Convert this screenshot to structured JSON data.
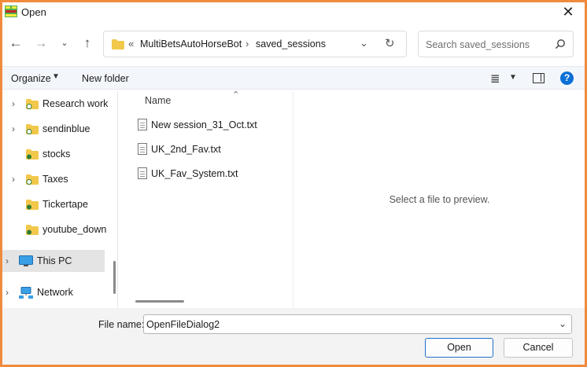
{
  "window": {
    "title": "Open",
    "icon": "app-icon",
    "close_icon": "close-icon"
  },
  "nav": {
    "back_icon": "back-arrow-icon",
    "forward_icon": "forward-arrow-icon",
    "recent_icon": "chevron-down-icon",
    "up_icon": "up-arrow-icon",
    "address": {
      "overflow": "«",
      "crumbs": [
        "MultiBetsAutoHorseBot",
        "saved_sessions"
      ],
      "separator": "›"
    },
    "search_placeholder": "Search saved_sessions"
  },
  "toolbar": {
    "organize_label": "Organize",
    "new_folder_label": "New folder",
    "help_label": "?"
  },
  "sidebar": {
    "items": [
      {
        "label": "Research work",
        "icon": "folder-sync-icon",
        "expandable": true
      },
      {
        "label": "sendinblue",
        "icon": "folder-sync-icon",
        "expandable": true
      },
      {
        "label": "stocks",
        "icon": "folder-check-icon",
        "expandable": false
      },
      {
        "label": "Taxes",
        "icon": "folder-sync-icon",
        "expandable": true
      },
      {
        "label": "Tickertape",
        "icon": "folder-check-icon",
        "expandable": false
      },
      {
        "label": "youtube_down",
        "icon": "folder-check-icon",
        "expandable": false
      },
      {
        "label": "This PC",
        "icon": "monitor-icon",
        "expandable": true,
        "selected": true
      },
      {
        "label": "Network",
        "icon": "network-icon",
        "expandable": true
      }
    ]
  },
  "filelist": {
    "column_name": "Name",
    "files": [
      {
        "name": "New session_31_Oct.txt"
      },
      {
        "name": "UK_2nd_Fav.txt"
      },
      {
        "name": "UK_Fav_System.txt"
      }
    ]
  },
  "preview": {
    "text": "Select a file to preview."
  },
  "bottom": {
    "file_name_label": "File name:",
    "file_name_value": "OpenFileDialog2",
    "open_label": "Open",
    "cancel_label": "Cancel"
  },
  "colors": {
    "border_accent": "#f08a3c",
    "help_blue": "#0b6fd6",
    "folder_yellow": "#f2c84b"
  }
}
